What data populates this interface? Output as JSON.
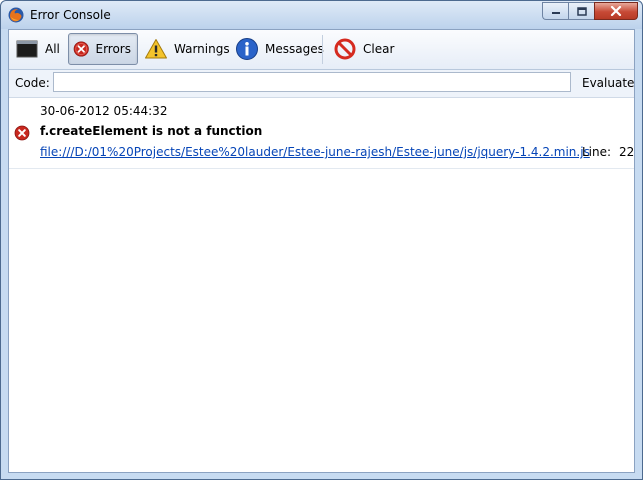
{
  "window": {
    "title": "Error Console"
  },
  "toolbar": {
    "buttons": [
      {
        "id": "all",
        "label": "All",
        "icon": "console-icon",
        "active": false
      },
      {
        "id": "errors",
        "label": "Errors",
        "icon": "error-icon",
        "active": true
      },
      {
        "id": "warnings",
        "label": "Warnings",
        "icon": "warning-icon",
        "active": false
      },
      {
        "id": "messages",
        "label": "Messages",
        "icon": "info-icon",
        "active": false
      },
      {
        "id": "clear",
        "label": "Clear",
        "icon": "clear-icon",
        "active": false
      }
    ]
  },
  "codebar": {
    "label": "Code:",
    "value": "",
    "evaluate_label": "Evaluate"
  },
  "entries": [
    {
      "timestamp": "30-06-2012 05:44:32",
      "message": "f.createElement is not a function",
      "source": "file:///D:/01%20Projects/Estee%20lauder/Estee-june-rajesh/Estee-june/js/jquery-1.4.2.min.js",
      "line_label": "Line:",
      "line": "22"
    }
  ],
  "colors": {
    "error_red": "#c8281f",
    "warning_yellow": "#f4c42c",
    "info_blue": "#2a63c9",
    "link_blue": "#0645b7",
    "frame_blue": "#c7dbf1"
  }
}
